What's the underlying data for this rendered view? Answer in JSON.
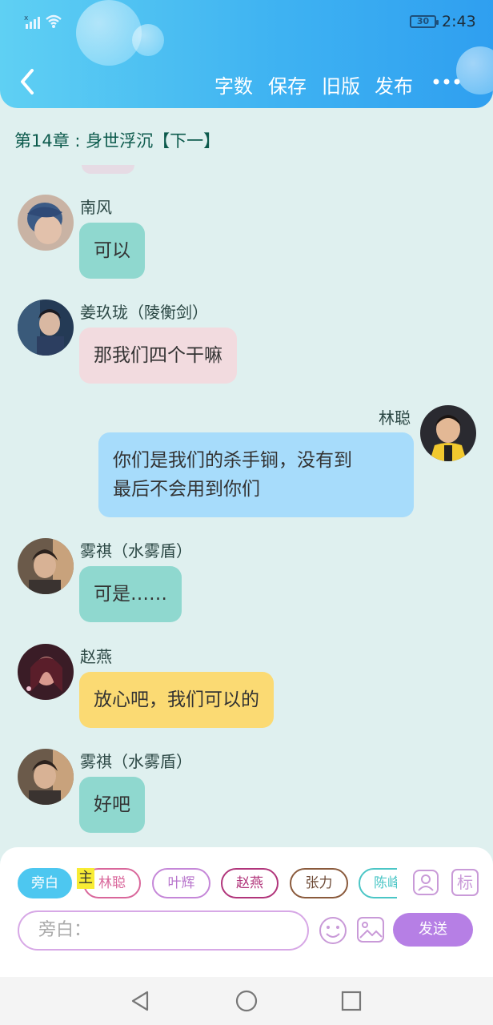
{
  "status_bar": {
    "time": "2:43",
    "battery": "30"
  },
  "header": {
    "nav_items": [
      "字数",
      "保存",
      "旧版",
      "发布"
    ]
  },
  "chapter_title": "第14章 : 身世浮沉【下一】",
  "messages": [
    {
      "sender": "南风",
      "text": "可以"
    },
    {
      "sender": "姜玖珑（陵衡剑）",
      "text": "那我们四个干嘛"
    },
    {
      "sender": "林聪",
      "line1": "你们是我们的杀手锏，没有到",
      "line2": "最后不会用到你们"
    },
    {
      "sender": "雾祺（水雾盾）",
      "text": "可是……"
    },
    {
      "sender": "赵燕",
      "text": "放心吧，我们可以的"
    },
    {
      "sender": "雾祺（水雾盾）",
      "text": "好吧"
    }
  ],
  "composer": {
    "chips": [
      "旁白",
      "林聪",
      "叶辉",
      "赵燕",
      "张力",
      "陈峰"
    ],
    "main_badge": "主",
    "tag_button": "标",
    "input_placeholder": "旁白：",
    "send_label": "发送"
  },
  "colors": {
    "header_start": "#5fd0f3",
    "header_end": "#2f9ff0",
    "background": "#dff0ef",
    "send_button": "#b67fe5"
  }
}
